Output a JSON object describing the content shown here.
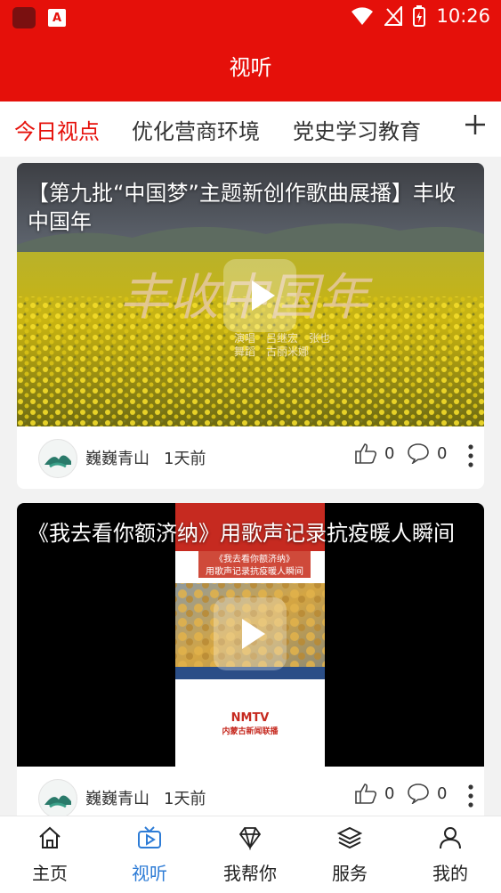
{
  "status_bar": {
    "time": "10:26"
  },
  "header": {
    "title": "视听"
  },
  "tabs": [
    {
      "label": "今日视点",
      "active": true
    },
    {
      "label": "优化营商环境",
      "active": false
    },
    {
      "label": "党史学习教育",
      "active": false
    }
  ],
  "tab_add_icon": "plus-icon",
  "feed": [
    {
      "title": "【第九批“中国梦”主题新创作歌曲展播】丰收中国年",
      "overlay_text": "丰收中国年",
      "credits": [
        "演唱　吕继宏　张也",
        "舞蹈　古丽米娜"
      ],
      "author": "巍巍青山",
      "time": "1天前",
      "likes": "0",
      "comments": "0"
    },
    {
      "title": "《我去看你额济纳》用歌声记录抗疫暖人瞬间",
      "overlay_banner": [
        "《我去看你额济纳》",
        "用歌声记录抗疫暖人瞬间"
      ],
      "logo_text": "NMTV",
      "logo_sub": "内蒙古新闻联播",
      "author": "巍巍青山",
      "time": "1天前",
      "likes": "0",
      "comments": "0"
    }
  ],
  "bottom_nav": [
    {
      "label": "主页",
      "icon": "home-icon",
      "active": false
    },
    {
      "label": "视听",
      "icon": "tv-icon",
      "active": true
    },
    {
      "label": "我帮你",
      "icon": "diamond-icon",
      "active": false
    },
    {
      "label": "服务",
      "icon": "layers-icon",
      "active": false
    },
    {
      "label": "我的",
      "icon": "person-icon",
      "active": false
    }
  ],
  "colors": {
    "brand_red": "#e5100a",
    "nav_active": "#2e7cd6"
  }
}
